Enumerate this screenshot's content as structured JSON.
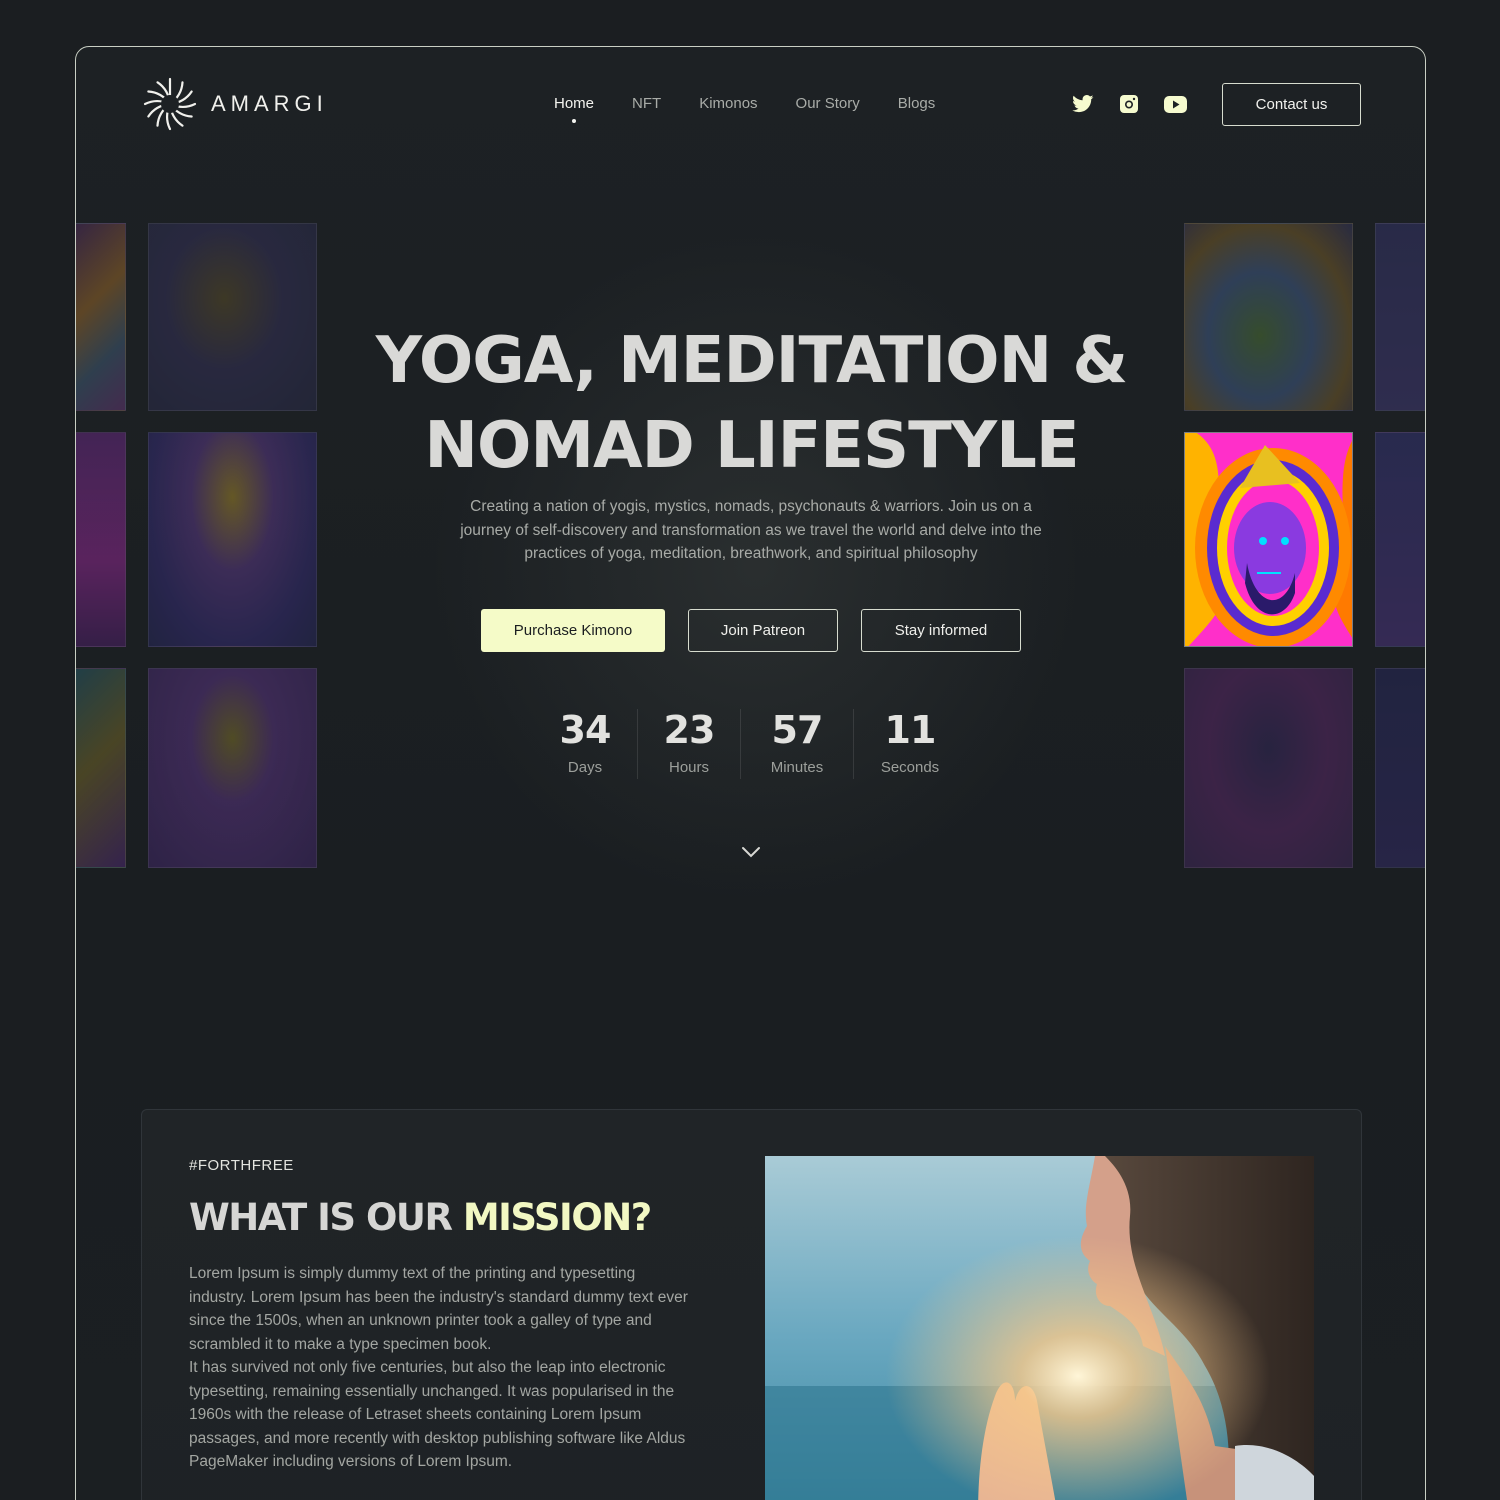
{
  "brand": {
    "name": "AMARGI",
    "logo_icon": "sun-spiral-logo"
  },
  "nav": {
    "items": [
      {
        "label": "Home",
        "active": true
      },
      {
        "label": "NFT",
        "active": false
      },
      {
        "label": "Kimonos",
        "active": false
      },
      {
        "label": "Our Story",
        "active": false
      },
      {
        "label": "Blogs",
        "active": false
      }
    ]
  },
  "socials": [
    {
      "icon": "twitter-icon"
    },
    {
      "icon": "instagram-icon"
    },
    {
      "icon": "youtube-icon"
    }
  ],
  "header": {
    "contact_label": "Contact us"
  },
  "hero": {
    "title_line1": "YOGA, MEDITATION &",
    "title_line2": "NOMAD LIFESTYLE",
    "subtitle": "Creating a nation of yogis, mystics, nomads, psychonauts & warriors. Join us on a journey of self-discovery and transformation as we travel the world and delve into the practices of yoga, meditation, breathwork, and spiritual philosophy",
    "buttons": {
      "purchase": "Purchase Kimono",
      "patreon": "Join Patreon",
      "stay": "Stay informed"
    },
    "countdown": [
      {
        "value": "34",
        "label": "Days"
      },
      {
        "value": "23",
        "label": "Hours"
      },
      {
        "value": "57",
        "label": "Minutes"
      },
      {
        "value": "11",
        "label": "Seconds"
      }
    ],
    "scroll_icon": "chevron-down-icon"
  },
  "mission": {
    "tag": "#FORTHFREE",
    "title_part1": "WHAT IS OUR ",
    "title_highlight": "MISSION?",
    "paragraph1": "Lorem Ipsum is simply dummy text of the printing and typesetting industry. Lorem Ipsum has been the industry's standard dummy text ever since the 1500s, when an unknown printer took a galley of type and scrambled it to make a type specimen book.",
    "paragraph2": "It has survived not only five centuries, but also the leap into electronic typesetting, remaining essentially unchanged. It was popularised in the 1960s with the release of Letraset sheets containing Lorem Ipsum passages, and more recently with desktop publishing software like Aldus PageMaker including versions of Lorem Ipsum."
  },
  "colors": {
    "background": "#1b1e21",
    "accent": "#f5fbc8",
    "frame_border": "#c9cfc4",
    "text_muted": "#a8aba7"
  }
}
